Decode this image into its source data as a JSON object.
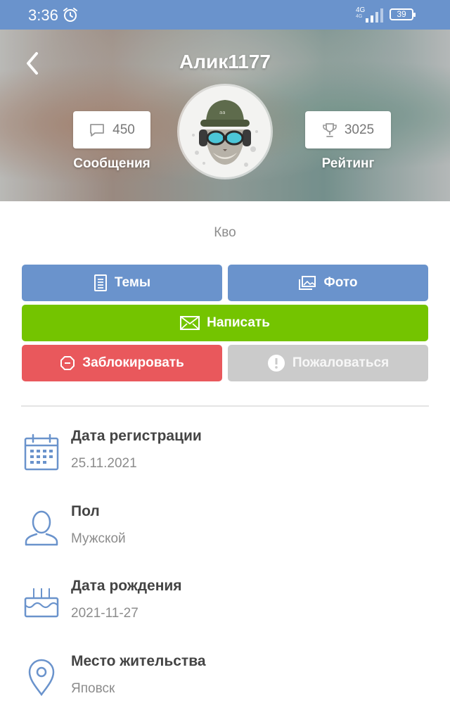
{
  "status_bar": {
    "time": "3:36",
    "network_top": "4G",
    "network_bottom": "4G",
    "battery": "39"
  },
  "profile": {
    "username": "Алик1177",
    "status": "Кво",
    "messages": {
      "count": "450",
      "label": "Сообщения",
      "icon": "speech-bubble-icon"
    },
    "rating": {
      "count": "3025",
      "label": "Рейтинг",
      "icon": "trophy-icon"
    }
  },
  "actions": {
    "themes": "Темы",
    "photo": "Фото",
    "write": "Написать",
    "block": "Заблокировать",
    "report": "Пожаловаться"
  },
  "info": [
    {
      "title": "Дата регистрации",
      "value": "25.11.2021",
      "icon": "calendar-icon"
    },
    {
      "title": "Пол",
      "value": "Мужской",
      "icon": "person-icon"
    },
    {
      "title": "Дата рождения",
      "value": "2021-11-27",
      "icon": "birthday-cake-icon"
    },
    {
      "title": "Место жительства",
      "value": "Яповск",
      "icon": "location-pin-icon"
    }
  ],
  "colors": {
    "accent_blue": "#6a93cc",
    "green": "#74c400",
    "red": "#e9585c",
    "gray": "#cbcbcb",
    "icon_blue": "#6a93cc"
  }
}
